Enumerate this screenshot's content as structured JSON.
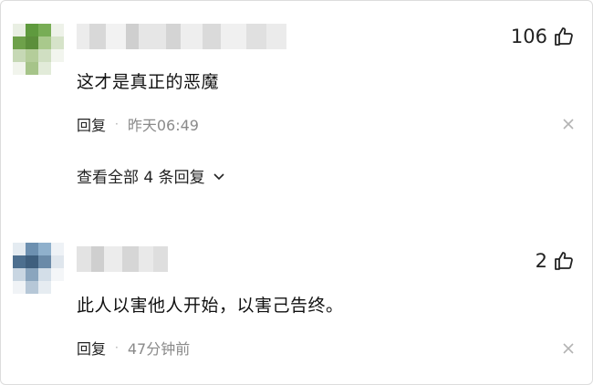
{
  "comments": [
    {
      "likes": "106",
      "text": "这才是真正的恶魔",
      "reply_label": "回复",
      "separator": "·",
      "time": "昨天06:49",
      "view_all": "查看全部 4 条回复",
      "icons": {
        "like": "thumbs-up-icon",
        "close": "close-icon",
        "expand": "chevron-down-icon"
      }
    },
    {
      "likes": "2",
      "text": "此人以害他人开始，以害己告终。",
      "reply_label": "回复",
      "separator": "·",
      "time": "47分钟前",
      "icons": {
        "like": "thumbs-up-icon",
        "close": "close-icon"
      }
    }
  ],
  "colors": {
    "text": "#222222",
    "muted": "#8a8a8a",
    "avatar1": [
      "#5f9a3e",
      "#9cc27a",
      "#c9d9b9",
      "#e6ede0"
    ],
    "avatar2": [
      "#4d6f8f",
      "#87a7c4",
      "#c7d4e0",
      "#e8edf2"
    ]
  }
}
